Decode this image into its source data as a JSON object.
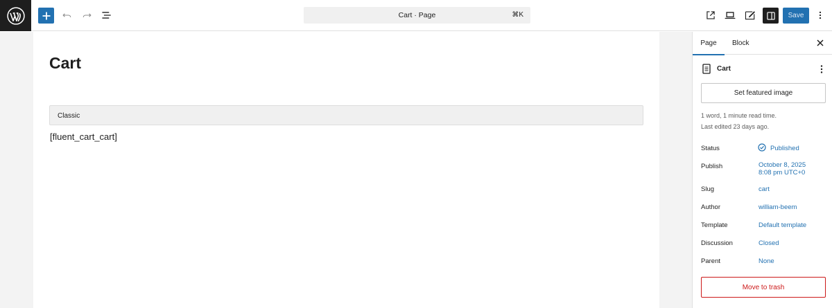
{
  "topbar": {
    "command_bar": "Cart · Page",
    "command_shortcut": "⌘K",
    "save_label": "Save"
  },
  "editor": {
    "title": "Cart",
    "classic_label": "Classic",
    "shortcode": "[fluent_cart_cart]"
  },
  "sidebar": {
    "tabs": [
      "Page",
      "Block"
    ],
    "doc_title": "Cart",
    "featured_image_label": "Set featured image",
    "meta": [
      "1 word, 1 minute read time.",
      "Last edited 23 days ago."
    ],
    "props": [
      {
        "label": "Status",
        "value": "Published"
      },
      {
        "label": "Publish",
        "value": "October 8, 2025\n8:08 pm UTC+0"
      },
      {
        "label": "Slug",
        "value": "cart"
      },
      {
        "label": "Author",
        "value": "william-beem"
      },
      {
        "label": "Template",
        "value": "Default template"
      },
      {
        "label": "Discussion",
        "value": "Closed"
      },
      {
        "label": "Parent",
        "value": "None"
      }
    ],
    "trash_label": "Move to trash"
  },
  "colors": {
    "accent": "#2271b1",
    "danger": "#cc1818",
    "dark": "#1e1e1e"
  }
}
